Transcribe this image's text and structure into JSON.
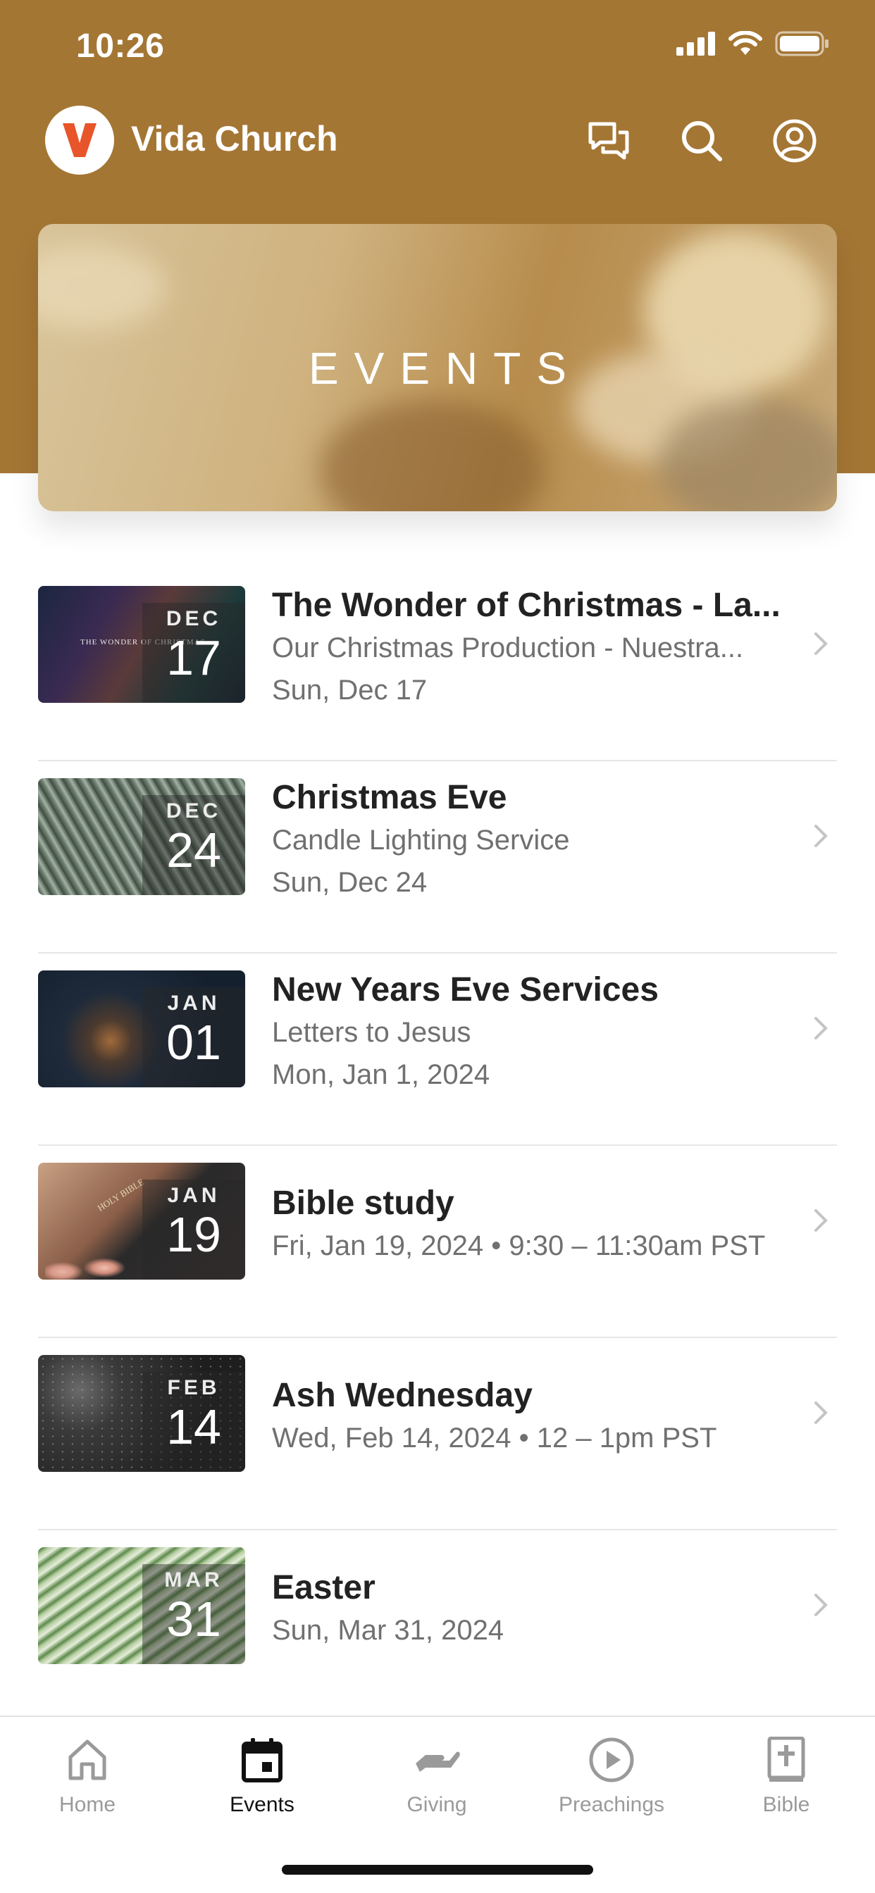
{
  "status_bar": {
    "time": "10:26"
  },
  "app_bar": {
    "title": "Vida Church",
    "logo_letter": "V",
    "actions": [
      "chat-icon",
      "search-icon",
      "account-icon"
    ]
  },
  "colors": {
    "header": "#a47634",
    "logo": "#e8552a",
    "active_tab": "#111111",
    "inactive_tab": "#9a9a9a"
  },
  "hero": {
    "title": "EVENTS"
  },
  "events": [
    {
      "month": "DEC",
      "day": "17",
      "title": "The Wonder of Christmas -  La...",
      "lines": [
        "Our Christmas Production - Nuestra...",
        "Sun, Dec 17"
      ],
      "thumb_text": "THE WONDER OF CHRISTMAS"
    },
    {
      "month": "DEC",
      "day": "24",
      "title": "Christmas Eve",
      "lines": [
        "Candle Lighting Service",
        "Sun, Dec 24"
      ]
    },
    {
      "month": "JAN",
      "day": "01",
      "title": "New Years Eve Services",
      "lines": [
        "Letters to Jesus",
        "Mon, Jan 1, 2024"
      ]
    },
    {
      "month": "JAN",
      "day": "19",
      "title": "Bible study",
      "lines": [
        "Fri, Jan 19, 2024 • 9:30 – 11:30am PST"
      ],
      "thumb_text": "HOLY BIBLE"
    },
    {
      "month": "FEB",
      "day": "14",
      "title": "Ash Wednesday",
      "lines": [
        "Wed, Feb 14, 2024 • 12 – 1pm PST"
      ]
    },
    {
      "month": "MAR",
      "day": "31",
      "title": "Easter",
      "lines": [
        "Sun, Mar 31, 2024"
      ]
    }
  ],
  "tabs": [
    {
      "label": "Home",
      "icon": "home-icon",
      "active": false
    },
    {
      "label": "Events",
      "icon": "calendar-icon",
      "active": true
    },
    {
      "label": "Giving",
      "icon": "giving-hand-icon",
      "active": false
    },
    {
      "label": "Preachings",
      "icon": "play-circle-icon",
      "active": false
    },
    {
      "label": "Bible",
      "icon": "bible-icon",
      "active": false
    }
  ]
}
